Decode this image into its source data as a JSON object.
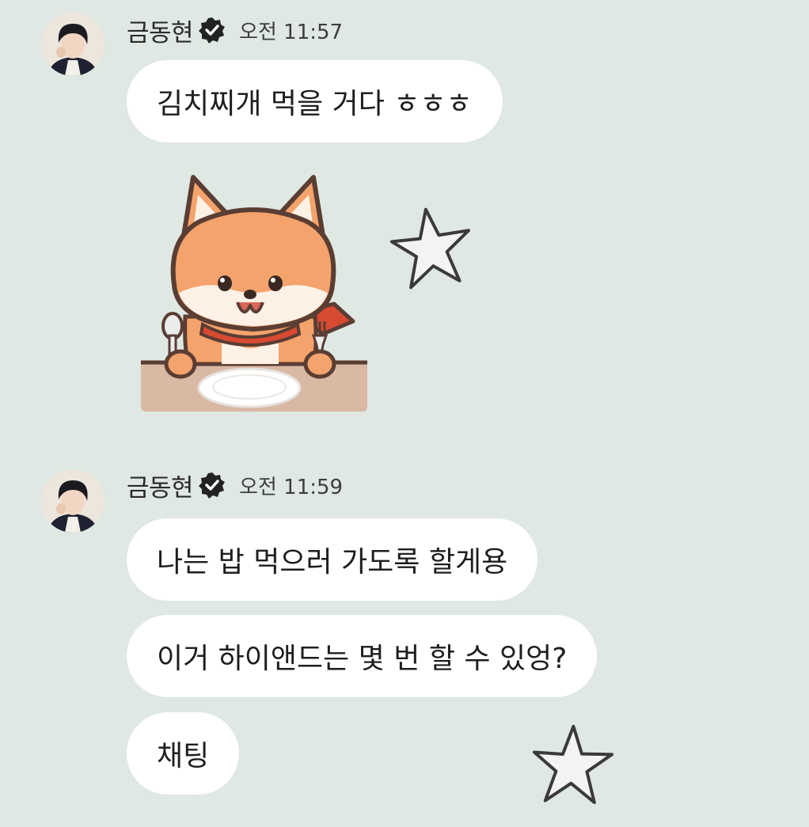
{
  "messages": [
    {
      "sender": "금동현",
      "time": "오전 11:57",
      "bubbles": [
        "김치찌개 먹을 거다 ㅎㅎㅎ"
      ],
      "sticker": "fox-eating-sticker"
    },
    {
      "sender": "금동현",
      "time": "오전 11:59",
      "bubbles": [
        "나는 밥 먹으러 가도록 할게용",
        "이거 하이앤드는 몇 번 할 수 있엉?",
        "채팅"
      ]
    }
  ],
  "colors": {
    "background": "#dfe8e2",
    "bubble": "#ffffff",
    "fox_orange": "#f4a36c",
    "verified": "#222222"
  }
}
